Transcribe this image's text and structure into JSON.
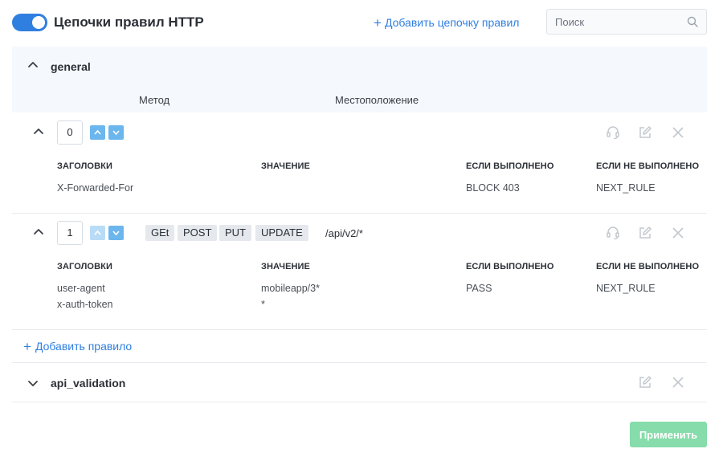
{
  "header": {
    "title": "Цепочки правил HTTP",
    "enabled": true,
    "add_chain_label": "Добавить цепочку правил",
    "search_placeholder": "Поиск"
  },
  "chains": [
    {
      "name": "general",
      "expanded": true,
      "columns": {
        "method": "Метод",
        "location": "Местоположение"
      },
      "rules": [
        {
          "order": "0",
          "methods": [],
          "location": "",
          "table_headers": [
            "ЗАГОЛОВКИ",
            "ЗНАЧЕНИЕ",
            "ЕСЛИ ВЫПОЛНЕНО",
            "ЕСЛИ НЕ ВЫПОЛНЕНО"
          ],
          "headers": [
            "X-Forwarded-For"
          ],
          "values": [
            ""
          ],
          "on_match": "BLOCK 403",
          "on_no_match": "NEXT_RULE"
        },
        {
          "order": "1",
          "methods": [
            "GEt",
            "POST",
            "PUT",
            "UPDATE"
          ],
          "location": "/api/v2/*",
          "table_headers": [
            "ЗАГОЛОВКИ",
            "ЗНАЧЕНИЕ",
            "ЕСЛИ ВЫПОЛНЕНО",
            "ЕСЛИ НЕ ВЫПОЛНЕНО"
          ],
          "headers": [
            "user-agent",
            "x-auth-token"
          ],
          "values": [
            "mobileapp/3*",
            "*"
          ],
          "on_match": "PASS",
          "on_no_match": "NEXT_RULE"
        }
      ],
      "add_rule_label": "Добавить правило"
    },
    {
      "name": "api_validation",
      "expanded": false
    }
  ],
  "footer": {
    "apply_label": "Применить"
  },
  "colors": {
    "accent": "#2f7fe0",
    "apply": "#86dcaa",
    "header_bg": "#f5f8fc"
  },
  "icons": [
    "search-icon",
    "chevron-up-icon",
    "chevron-down-icon",
    "arrow-up-icon",
    "arrow-down-icon",
    "headset-icon",
    "edit-icon",
    "close-icon",
    "plus-icon"
  ]
}
